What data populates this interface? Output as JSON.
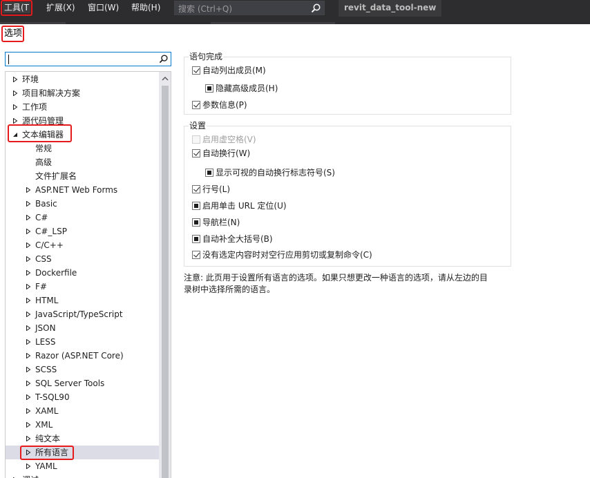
{
  "menubar": {
    "items": [
      {
        "label": "工具(T"
      },
      {
        "label": "扩展(X)"
      },
      {
        "label": "窗口(W)"
      },
      {
        "label": "帮助(H)"
      }
    ],
    "search_placeholder": "搜索 (Ctrl+Q)",
    "project_title": "revit_data_tool-new"
  },
  "dialog": {
    "title": "选项"
  },
  "tree": {
    "items": [
      {
        "label": "环境",
        "expanded": false,
        "level": 0
      },
      {
        "label": "项目和解决方案",
        "expanded": false,
        "level": 0
      },
      {
        "label": "工作项",
        "expanded": false,
        "level": 0
      },
      {
        "label": "源代码管理",
        "expanded": false,
        "level": 0
      },
      {
        "label": "文本编辑器",
        "expanded": true,
        "level": 0
      },
      {
        "label": "常规",
        "leaf": true,
        "level": 1
      },
      {
        "label": "高级",
        "leaf": true,
        "level": 1
      },
      {
        "label": "文件扩展名",
        "leaf": true,
        "level": 1
      },
      {
        "label": "ASP.NET Web Forms",
        "expanded": false,
        "level": 1
      },
      {
        "label": "Basic",
        "expanded": false,
        "level": 1
      },
      {
        "label": "C#",
        "expanded": false,
        "level": 1
      },
      {
        "label": "C#_LSP",
        "expanded": false,
        "level": 1
      },
      {
        "label": "C/C++",
        "expanded": false,
        "level": 1
      },
      {
        "label": "CSS",
        "expanded": false,
        "level": 1
      },
      {
        "label": "Dockerfile",
        "expanded": false,
        "level": 1
      },
      {
        "label": "F#",
        "expanded": false,
        "level": 1
      },
      {
        "label": "HTML",
        "expanded": false,
        "level": 1
      },
      {
        "label": "JavaScript/TypeScript",
        "expanded": false,
        "level": 1
      },
      {
        "label": "JSON",
        "expanded": false,
        "level": 1
      },
      {
        "label": "LESS",
        "expanded": false,
        "level": 1
      },
      {
        "label": "Razor (ASP.NET Core)",
        "expanded": false,
        "level": 1
      },
      {
        "label": "SCSS",
        "expanded": false,
        "level": 1
      },
      {
        "label": "SQL Server Tools",
        "expanded": false,
        "level": 1
      },
      {
        "label": "T-SQL90",
        "expanded": false,
        "level": 1
      },
      {
        "label": "XAML",
        "expanded": false,
        "level": 1
      },
      {
        "label": "XML",
        "expanded": false,
        "level": 1
      },
      {
        "label": "纯文本",
        "expanded": false,
        "level": 1
      },
      {
        "label": "所有语言",
        "expanded": false,
        "level": 1,
        "selected": true
      },
      {
        "label": "YAML",
        "expanded": false,
        "level": 1
      },
      {
        "label": "调试",
        "expanded": false,
        "level": 0
      }
    ]
  },
  "statement_completion": {
    "label": "语句完成",
    "options": [
      {
        "label": "自动列出成员(M)",
        "state": "checked"
      },
      {
        "label": "隐藏高级成员(H)",
        "state": "indeterminate"
      },
      {
        "label": "参数信息(P)",
        "state": "checked"
      }
    ]
  },
  "settings": {
    "label": "设置",
    "options": [
      {
        "label": "启用虚空格(V)",
        "state": "disabled"
      },
      {
        "label": "自动换行(W)",
        "state": "checked"
      },
      {
        "label": "显示可视的自动换行标志符号(S)",
        "state": "indeterminate"
      },
      {
        "label": "行号(L)",
        "state": "checked"
      },
      {
        "label": "启用单击 URL 定位(U)",
        "state": "indeterminate"
      },
      {
        "label": "导航栏(N)",
        "state": "indeterminate"
      },
      {
        "label": "自动补全大括号(B)",
        "state": "indeterminate"
      },
      {
        "label": "没有选定内容时对空行应用剪切或复制命令(C)",
        "state": "checked"
      }
    ]
  },
  "note": {
    "line1": "注意: 此页用于设置所有语言的选项。如果只想更改一种语言的选项，请从左边的目",
    "line2": "录树中选择所需的语言。"
  },
  "colors": {
    "menubar_bg": "#2d2d30",
    "accent": "#007acc",
    "highlight_red": "#e51b1b",
    "selection_bg": "#dcdce6"
  }
}
